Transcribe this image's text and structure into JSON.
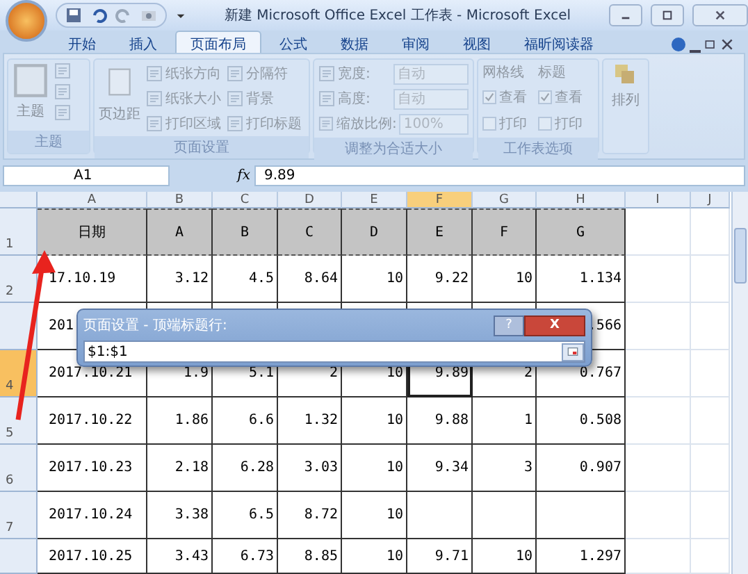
{
  "window": {
    "title": "新建 Microsoft Office Excel 工作表 - Microsoft Excel"
  },
  "tabs": [
    {
      "label": "开始",
      "selected": false
    },
    {
      "label": "插入",
      "selected": false
    },
    {
      "label": "页面布局",
      "selected": true
    },
    {
      "label": "公式",
      "selected": false
    },
    {
      "label": "数据",
      "selected": false
    },
    {
      "label": "审阅",
      "selected": false
    },
    {
      "label": "视图",
      "selected": false
    },
    {
      "label": "福昕阅读器",
      "selected": false
    }
  ],
  "ribbon": {
    "disabled": true,
    "theme_group": {
      "label": "主题",
      "button": "主题"
    },
    "page_setup": {
      "label": "页面设置",
      "button": "页边距",
      "items": [
        {
          "label": "纸张方向"
        },
        {
          "label": "纸张大小"
        },
        {
          "label": "打印区域"
        },
        {
          "label": "分隔符"
        },
        {
          "label": "背景"
        },
        {
          "label": "打印标题"
        }
      ]
    },
    "scale": {
      "label": "调整为合适大小",
      "fields": [
        {
          "label": "宽度:",
          "value": "自动"
        },
        {
          "label": "高度:",
          "value": "自动"
        },
        {
          "label": "缩放比例:",
          "value": "100%"
        }
      ]
    },
    "sheet_options": {
      "label": "工作表选项",
      "columns": [
        {
          "title": "网格线",
          "options": [
            {
              "label": "查看",
              "checked": true
            },
            {
              "label": "打印",
              "checked": false
            }
          ]
        },
        {
          "title": "标题",
          "options": [
            {
              "label": "查看",
              "checked": true
            },
            {
              "label": "打印",
              "checked": false
            }
          ]
        }
      ]
    },
    "arrange": {
      "label": "排列"
    }
  },
  "formula_bar": {
    "name_box": "A1",
    "function_label": "fx",
    "value": "9.89"
  },
  "sheet": {
    "columns": [
      {
        "label": "A",
        "selected": false
      },
      {
        "label": "B",
        "selected": false
      },
      {
        "label": "C",
        "selected": false
      },
      {
        "label": "D",
        "selected": false
      },
      {
        "label": "E",
        "selected": false
      },
      {
        "label": "F",
        "selected": true
      },
      {
        "label": "G",
        "selected": false
      },
      {
        "label": "H",
        "selected": false
      },
      {
        "label": "I",
        "selected": false
      },
      {
        "label": "J",
        "selected": false
      }
    ],
    "rows": [
      {
        "header": "1",
        "selected": false,
        "print_title": true,
        "cells": [
          "日期",
          "A",
          "B",
          "C",
          "D",
          "E",
          "F",
          "G"
        ]
      },
      {
        "header": "2",
        "selected": false,
        "print_title": false,
        "cells": [
          "17.10.19",
          "3.12",
          "4.5",
          "8.64",
          "10",
          "9.22",
          "10",
          "1.134"
        ]
      },
      {
        "header": "",
        "selected": false,
        "print_title": false,
        "cells": [
          "201",
          "",
          "",
          "",
          "",
          "",
          "",
          ".566"
        ]
      },
      {
        "header": "4",
        "selected": true,
        "print_title": false,
        "cells": [
          "2017.10.21",
          "1.9",
          "5.1",
          "2",
          "10",
          "9.89",
          "2",
          "0.767"
        ]
      },
      {
        "header": "5",
        "selected": false,
        "print_title": false,
        "cells": [
          "2017.10.22",
          "1.86",
          "6.6",
          "1.32",
          "10",
          "9.88",
          "1",
          "0.508"
        ]
      },
      {
        "header": "6",
        "selected": false,
        "print_title": false,
        "cells": [
          "2017.10.23",
          "2.18",
          "6.28",
          "3.03",
          "10",
          "9.34",
          "3",
          "0.907"
        ]
      },
      {
        "header": "7",
        "selected": false,
        "print_title": false,
        "cells": [
          "2017.10.24",
          "3.38",
          "6.5",
          "8.72",
          "10"
        ]
      },
      {
        "header": "",
        "selected": false,
        "print_title": false,
        "cells": [
          "2017.10.25",
          "3.43",
          "6.73",
          "8.85",
          "10",
          "9.71",
          "10",
          "1.297"
        ]
      }
    ]
  },
  "dialog": {
    "title": "页面设置 - 顶端标题行:",
    "help": "?",
    "close": "X",
    "value": "$1:$1"
  }
}
